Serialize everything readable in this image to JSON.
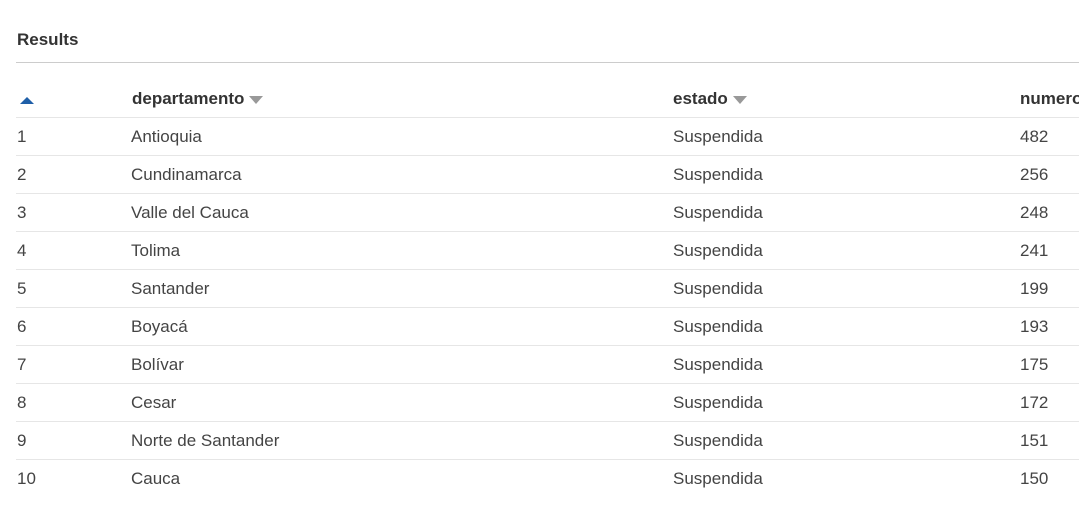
{
  "panel": {
    "title": "Results"
  },
  "table": {
    "columns": {
      "index": "",
      "departamento": "departamento",
      "estado": "estado",
      "numero": "numero"
    },
    "rows": [
      {
        "index": "1",
        "departamento": "Antioquia",
        "estado": "Suspendida",
        "numero": "482"
      },
      {
        "index": "2",
        "departamento": "Cundinamarca",
        "estado": "Suspendida",
        "numero": "256"
      },
      {
        "index": "3",
        "departamento": "Valle del Cauca",
        "estado": "Suspendida",
        "numero": "248"
      },
      {
        "index": "4",
        "departamento": "Tolima",
        "estado": "Suspendida",
        "numero": "241"
      },
      {
        "index": "5",
        "departamento": "Santander",
        "estado": "Suspendida",
        "numero": "199"
      },
      {
        "index": "6",
        "departamento": "Boyacá",
        "estado": "Suspendida",
        "numero": "193"
      },
      {
        "index": "7",
        "departamento": "Bolívar",
        "estado": "Suspendida",
        "numero": "175"
      },
      {
        "index": "8",
        "departamento": "Cesar",
        "estado": "Suspendida",
        "numero": "172"
      },
      {
        "index": "9",
        "departamento": "Norte de Santander",
        "estado": "Suspendida",
        "numero": "151"
      },
      {
        "index": "10",
        "departamento": "Cauca",
        "estado": "Suspendida",
        "numero": "150"
      }
    ]
  },
  "icons": {
    "sort": "sort-ascending-icon",
    "column_menu": "chevron-down-icon"
  },
  "colors": {
    "sort_indicator": "#1f5fa8",
    "dropdown_indicator": "#999999"
  }
}
